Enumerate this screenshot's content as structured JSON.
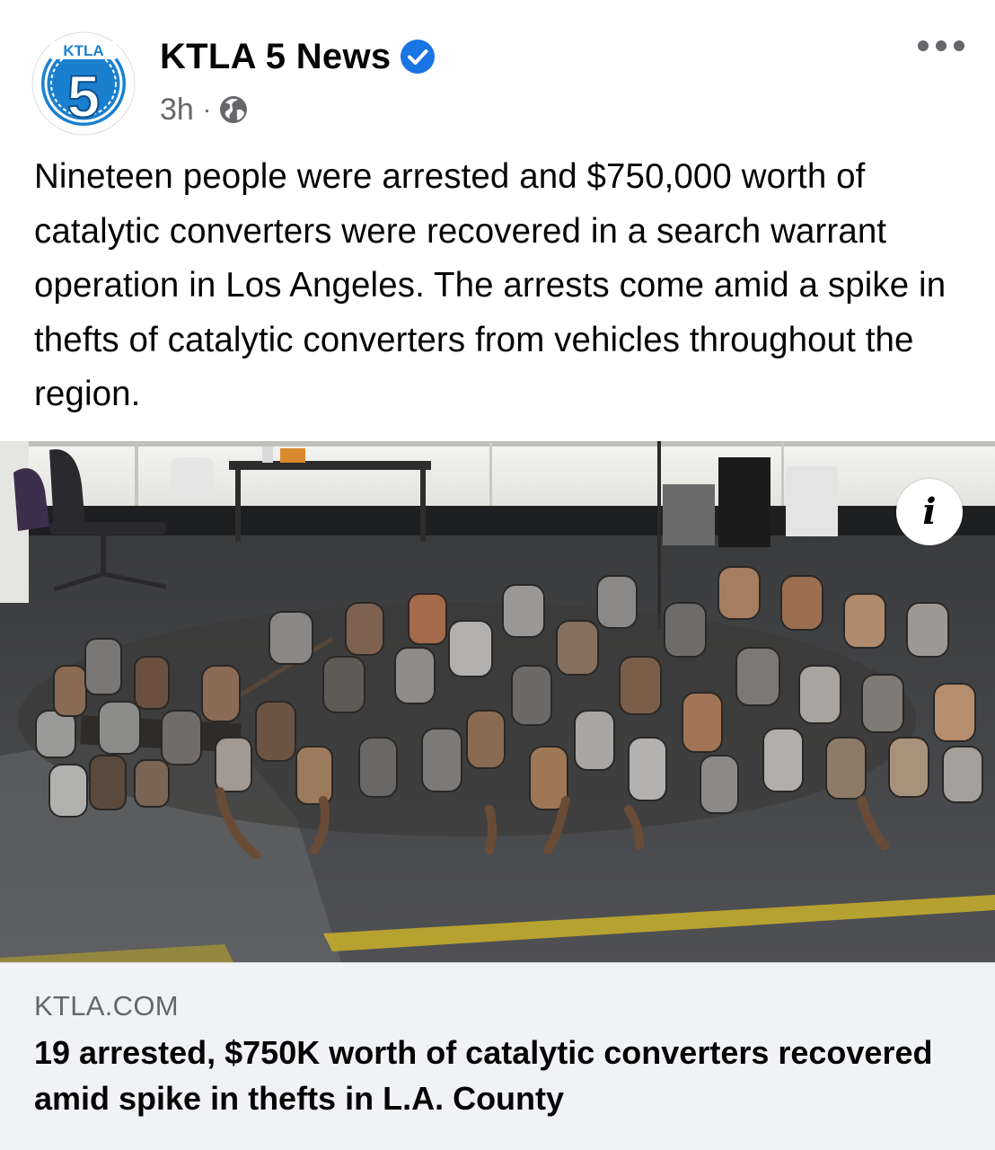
{
  "post": {
    "page_name": "KTLA 5 News",
    "verified_icon": "verified-badge-icon",
    "timestamp": "3h",
    "separator": "·",
    "audience_icon": "globe-icon",
    "more_icon": "more-options-icon",
    "text": "Nineteen people were arrested and $750,000 worth of catalytic converters were recovered in a search warrant operation in Los Angeles. The arrests come amid a spike in thefts of catalytic converters from vehicles throughout the region."
  },
  "avatar": {
    "logo_text": "KTLA",
    "logo_number": "5"
  },
  "photo": {
    "info_label": "i"
  },
  "link_preview": {
    "domain": "KTLA.COM",
    "headline": "19 arrested, $750K worth of catalytic converters recovered amid spike in thefts in L.A. County"
  },
  "colors": {
    "brand_blue": "#1b74e4",
    "text_primary": "#050505",
    "text_secondary": "#65676b",
    "card_background": "#f0f2f5"
  }
}
